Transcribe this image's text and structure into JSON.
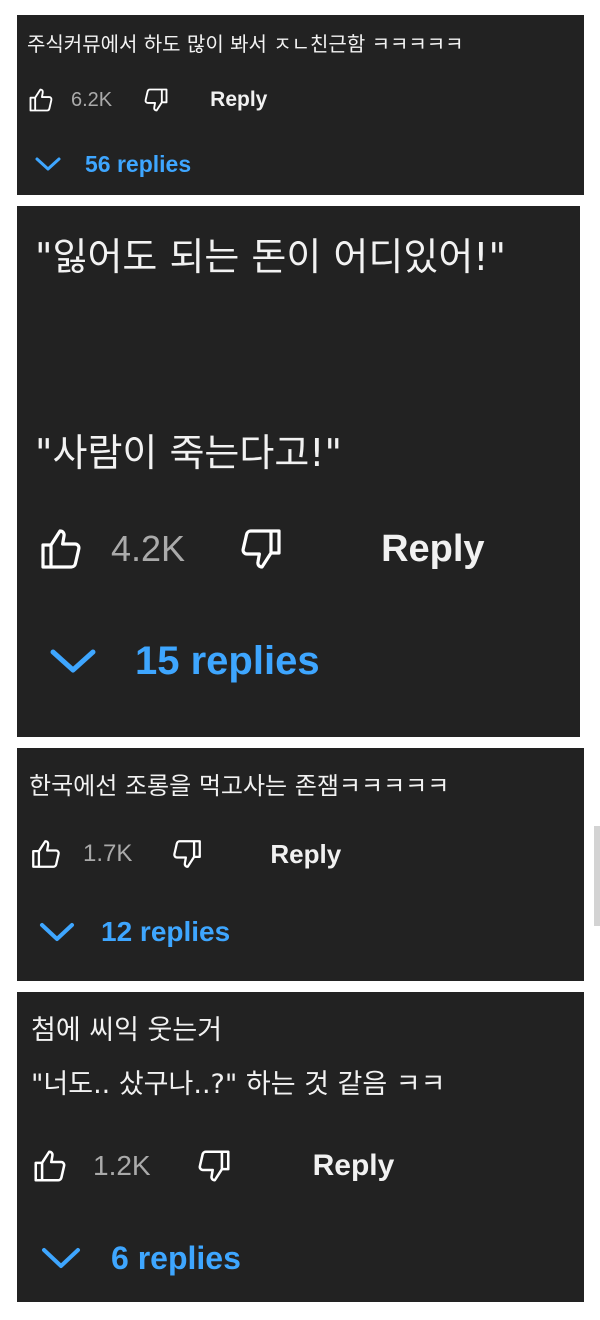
{
  "comments": [
    {
      "lines": [
        "주식커뮤에서 하도 많이 봐서 ㅈㄴ친근함 ㅋㅋㅋㅋㅋ"
      ],
      "likes": "6.2K",
      "reply_label": "Reply",
      "replies_label": "56 replies"
    },
    {
      "lines": [
        "\"잃어도 되는 돈이 어디있어!\"",
        "\"사람이 죽는다고!\""
      ],
      "likes": "4.2K",
      "reply_label": "Reply",
      "replies_label": "15 replies"
    },
    {
      "lines": [
        "한국에선 조롱을 먹고사는 존잼ㅋㅋㅋㅋㅋ"
      ],
      "likes": "1.7K",
      "reply_label": "Reply",
      "replies_label": "12 replies"
    },
    {
      "lines": [
        "첨에 씨익 웃는거",
        "\"너도.. 샀구나..?\" 하는 것 같음 ㅋㅋ"
      ],
      "likes": "1.2K",
      "reply_label": "Reply",
      "replies_label": "6 replies"
    }
  ],
  "colors": {
    "card_bg": "#222222",
    "text": "#f2f2f2",
    "count": "#aaaaaa",
    "link": "#3ea6ff"
  },
  "icons": [
    "thumbs-up-icon",
    "thumbs-down-icon",
    "chevron-down-icon"
  ]
}
